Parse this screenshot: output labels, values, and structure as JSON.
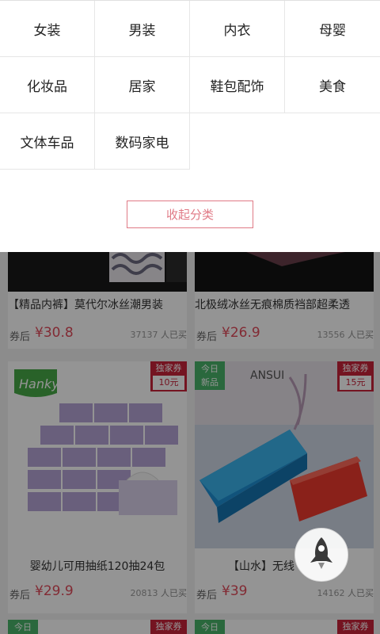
{
  "categories": [
    {
      "label": "女装"
    },
    {
      "label": "男装"
    },
    {
      "label": "内衣"
    },
    {
      "label": "母婴"
    },
    {
      "label": "化妆品"
    },
    {
      "label": "居家"
    },
    {
      "label": "鞋包配饰"
    },
    {
      "label": "美食"
    },
    {
      "label": "文体车品"
    },
    {
      "label": "数码家电"
    }
  ],
  "collapse_label": "收起分类",
  "products": [
    {
      "title": "【精品内裤】莫代尔冰丝潮男装",
      "price_prefix": "券后",
      "price": "¥30.8",
      "sold_count": "37137",
      "sold_suffix": "人已买"
    },
    {
      "title": "北极绒冰丝无痕棉质裆部超柔透",
      "price_prefix": "券后",
      "price": "¥26.9",
      "sold_count": "13556",
      "sold_suffix": "人已买"
    },
    {
      "title": "婴幼儿可用抽纸120抽24包",
      "price_prefix": "券后",
      "price": "¥29.9",
      "sold_count": "20813",
      "sold_suffix": "人已买",
      "badge": {
        "line1": "独家券",
        "line2": "10元"
      },
      "brand": "Hanky"
    },
    {
      "title": "【山水】无线",
      "price_prefix": "券后",
      "price": "¥39",
      "sold_count": "14162",
      "sold_suffix": "人已买",
      "badge": {
        "line1": "独家券",
        "line2": "15元"
      },
      "new_badge": {
        "line1": "今日",
        "line2": "新品"
      },
      "brand_partial": "ANSUI"
    }
  ],
  "bottom_cards": [
    {
      "new_badge": "今日",
      "badge": "独家券"
    },
    {
      "new_badge": "今日",
      "badge": "独家券"
    }
  ],
  "colors": {
    "accent": "#e07a86",
    "price": "#e04a5a",
    "exclusive_badge": "#c8233a",
    "new_badge": "#49b36a"
  },
  "icons": {
    "float_button": "rocket-icon"
  }
}
